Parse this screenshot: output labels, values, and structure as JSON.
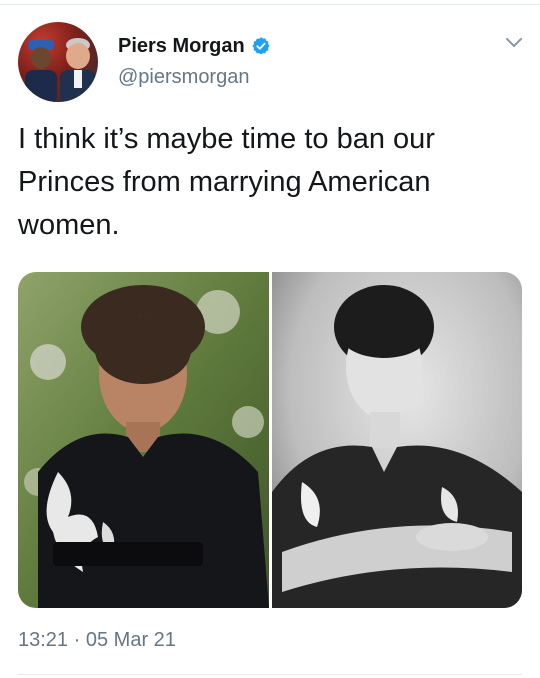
{
  "tweet": {
    "author_name": "Piers Morgan",
    "author_handle": "@piersmorgan",
    "text_lines": [
      "I think it’s maybe time to ban our",
      "Princes from marrying American",
      "women."
    ],
    "time": "13:21",
    "separator": "·",
    "date": "05 Mar 21"
  },
  "icons": {
    "verified": "verified-badge-icon",
    "menu": "chevron-down-icon"
  },
  "colors": {
    "verified_blue": "#1da1f2",
    "text_primary": "#14171a",
    "text_secondary": "#657786"
  }
}
